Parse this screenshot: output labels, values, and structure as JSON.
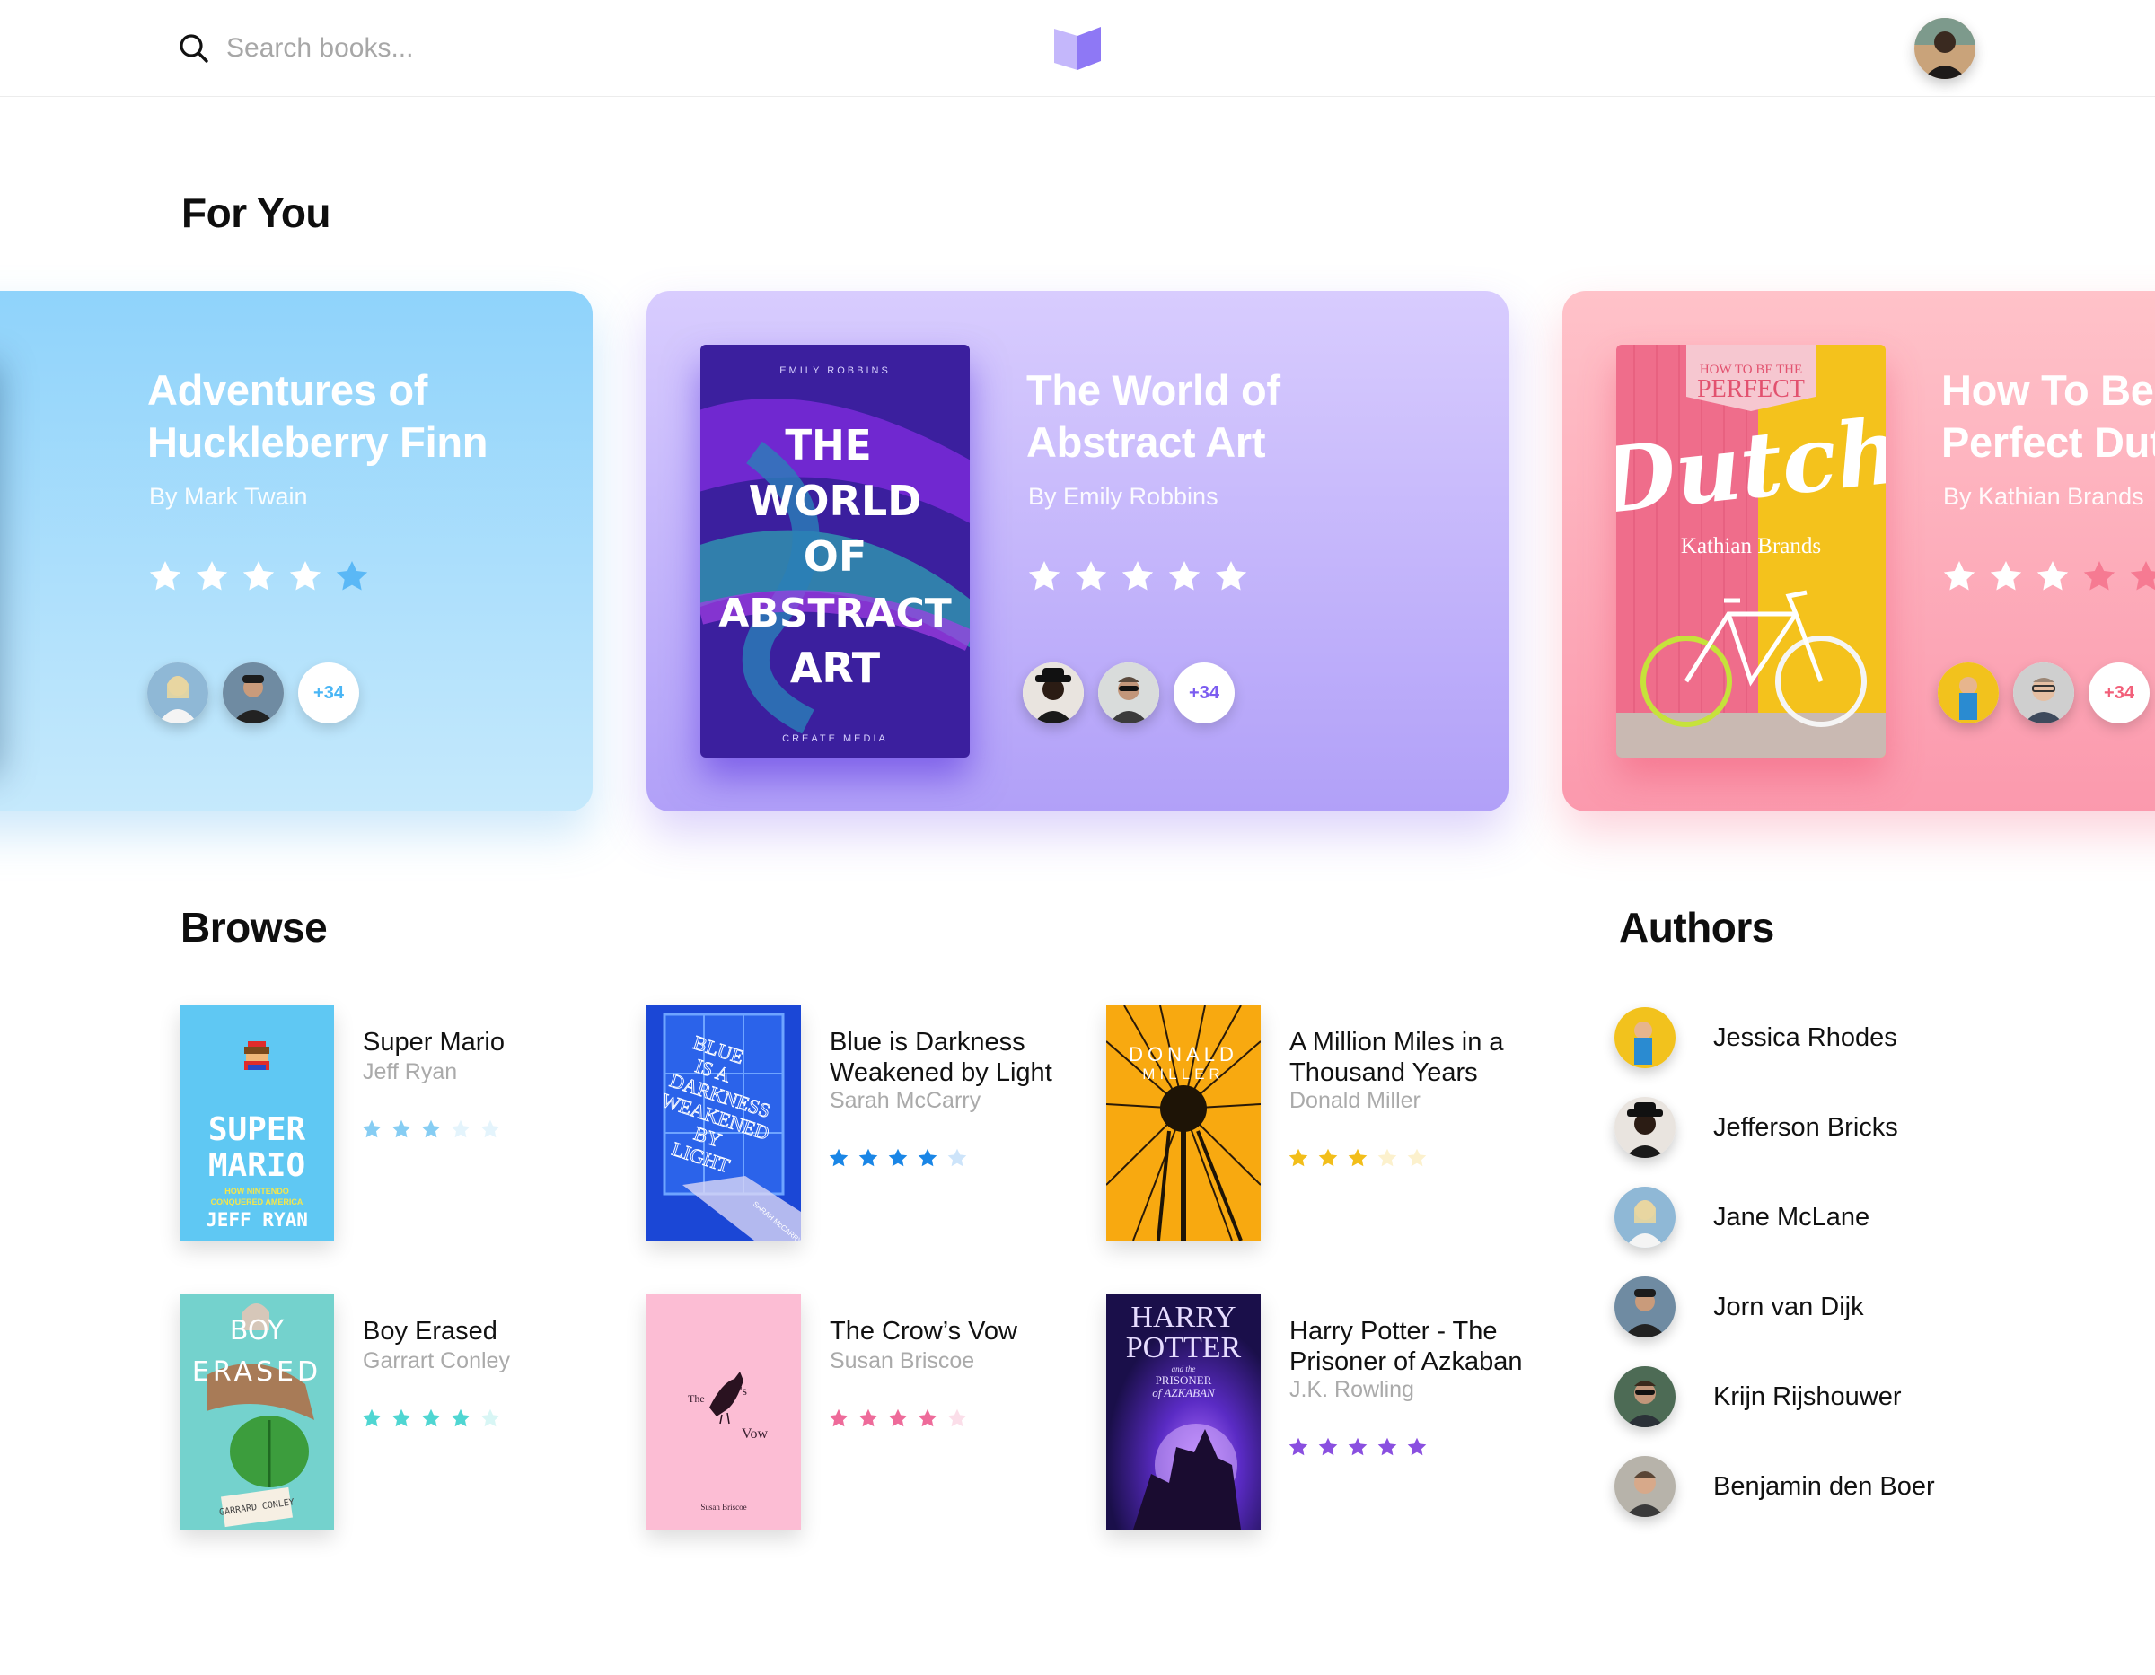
{
  "search": {
    "placeholder": "Search books..."
  },
  "sections": {
    "for_you": "For You",
    "browse": "Browse",
    "authors": "Authors"
  },
  "featured": [
    {
      "title": "Adventures of\nHuckleberry Finn",
      "author": "By Mark Twain",
      "rating": 4,
      "more_readers": "+34",
      "accent": "#4ab6f5"
    },
    {
      "title": "The World of\nAbstract Art",
      "author": "By Emily Robbins",
      "rating": 5,
      "more_readers": "+34",
      "accent": "#7b5cf0",
      "cover": {
        "top_text": "EMILY ROBBINS",
        "lines": [
          "THE",
          "WORLD",
          "OF",
          "ABSTRACT",
          "ART"
        ],
        "bottom_text": "CREATE MEDIA"
      }
    },
    {
      "title": "How To Be the\nPerfect Dutch",
      "author": "By Kathian Brands",
      "rating": 3,
      "more_readers": "+34",
      "accent": "#f2607a",
      "cover": {
        "top_text": "HOW TO BE THE",
        "big_text": "PERFECT",
        "script_text": "Dutch",
        "author_text": "Kathian Brands"
      }
    }
  ],
  "browse": [
    {
      "title": "Super Mario",
      "author": "Jeff Ryan",
      "rating": 3,
      "star_color": "#86cdf3",
      "cover": {
        "line1": "SUPER",
        "line2": "MARIO",
        "sub1": "HOW NINTENDO",
        "sub2": "CONQUERED AMERICA",
        "author": "JEFF RYAN"
      }
    },
    {
      "title": "Blue is Darkness Weakened by Light",
      "author": "Sarah McCarry",
      "rating": 4,
      "star_color": "#1a86e6",
      "cover": {
        "lines": [
          "BLUE",
          "IS A",
          "DARKNESS",
          "WEAKENED",
          "BY",
          "LIGHT"
        ],
        "author": "SARAH McCARRY"
      }
    },
    {
      "title": "A Million Miles in a Thousand Years",
      "author": "Donald Miller",
      "rating": 3,
      "star_color": "#f2be1a",
      "cover": {
        "line1": "DONALD",
        "line2": "MILLER"
      }
    },
    {
      "title": "Boy Erased",
      "author": "Garrart Conley",
      "rating": 4,
      "star_color": "#4fd6d2",
      "cover": {
        "line1": "BOY",
        "line2": "ERASED",
        "author": "GARRARD CONLEY"
      }
    },
    {
      "title": "The Crow’s Vow",
      "author": "Susan Briscoe",
      "rating": 4,
      "star_color": "#ee6b9a",
      "cover": {
        "the": "The",
        "s": "'s",
        "vow": "Vow",
        "author": "Susan Briscoe"
      }
    },
    {
      "title": "Harry Potter - The Prisoner of Azkaban",
      "author": "J.K. Rowling",
      "rating": 5,
      "star_color": "#8a4fe0",
      "cover": {
        "line1": "HARRY",
        "line2": "POTTER",
        "and_the": "and the",
        "sub1": "PRISONER",
        "sub2": "of AZKABAN"
      }
    }
  ],
  "authors": [
    {
      "name": "Jessica Rhodes"
    },
    {
      "name": "Jefferson Bricks"
    },
    {
      "name": "Jane McLane"
    },
    {
      "name": "Jorn van Dijk"
    },
    {
      "name": "Krijn Rijshouwer"
    },
    {
      "name": "Benjamin den Boer"
    }
  ]
}
